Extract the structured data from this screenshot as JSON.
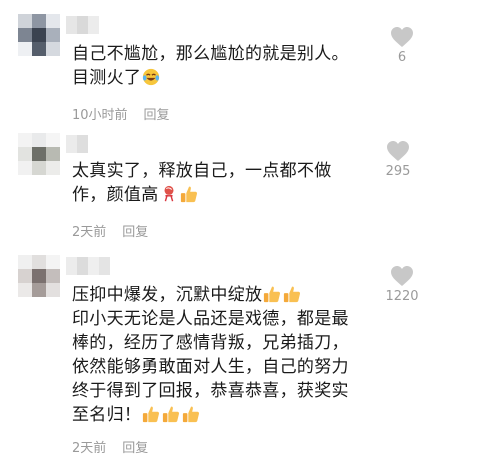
{
  "comments": [
    {
      "text_before": "自己不尴尬，那么尴尬的就是别人。\n目测火了",
      "emoji": [
        "laugh-cry-emoji"
      ],
      "time": "10小时前",
      "reply": "回复",
      "likes": "6"
    },
    {
      "text_before": "太真实了，释放自己，一点都不做\n作，颜值高",
      "emoji": [
        "lollipop-emoji",
        "thumbs-up-emoji"
      ],
      "time": "2天前",
      "reply": "回复",
      "likes": "295"
    },
    {
      "text_before": "压抑中爆发，沉默中绽放",
      "emoji_inline": [
        "thumbs-up-emoji",
        "thumbs-up-emoji"
      ],
      "text_after": "印小天无论是人品还是戏德，都是最\n棒的，经历了感情背叛，兄弟插刀，\n依然能够勇敢面对人生，自己的努力\n终于得到了回报，恭喜恭喜，获奖实\n至名归！",
      "emoji": [
        "thumbs-up-emoji",
        "thumbs-up-emoji",
        "thumbs-up-emoji"
      ],
      "time": "2天前",
      "reply": "回复",
      "likes": "1220"
    }
  ],
  "colors": {
    "text": "#1a1a1a",
    "meta": "#9a9a9a",
    "heart": "#c8c8c8"
  }
}
